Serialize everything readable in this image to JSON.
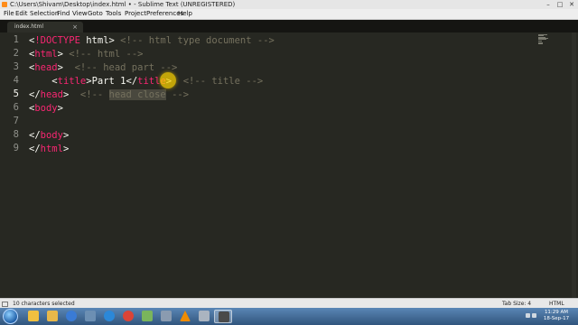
{
  "window": {
    "title": "C:\\Users\\Shivam\\Desktop\\index.html • - Sublime Text (UNREGISTERED)"
  },
  "menu": {
    "items": [
      "File",
      "Edit",
      "Selection",
      "Find",
      "View",
      "Goto",
      "Tools",
      "Project",
      "Preferences",
      "Help"
    ]
  },
  "tab": {
    "label": "index.html",
    "close_glyph": "×"
  },
  "editor": {
    "active_line": 5,
    "line_numbers": [
      "1",
      "2",
      "3",
      "4",
      "5",
      "6",
      "7",
      "8",
      "9"
    ],
    "lines": [
      {
        "indent": "",
        "tokens": [
          [
            "<",
            "punct"
          ],
          [
            "!DOCTYPE",
            "doctype"
          ],
          [
            " html",
            "text"
          ],
          [
            "> ",
            "punct"
          ],
          [
            "<!-- html type document -->",
            "comment"
          ]
        ]
      },
      {
        "indent": "",
        "tokens": [
          [
            "<",
            "punct"
          ],
          [
            "html",
            "tag"
          ],
          [
            "> ",
            "punct"
          ],
          [
            "<!-- html -->",
            "comment"
          ]
        ]
      },
      {
        "indent": "",
        "tokens": [
          [
            "<",
            "punct"
          ],
          [
            "head",
            "tag"
          ],
          [
            ">  ",
            "punct"
          ],
          [
            "<!-- head part -->",
            "comment"
          ]
        ]
      },
      {
        "indent": "    ",
        "tokens": [
          [
            "<",
            "punct"
          ],
          [
            "title",
            "tag"
          ],
          [
            ">",
            "punct"
          ],
          [
            "Part 1",
            "text"
          ],
          [
            "</",
            "punct"
          ],
          [
            "title",
            "tag"
          ],
          [
            ">  ",
            "punct"
          ],
          [
            "<!-- title -->",
            "comment"
          ]
        ]
      },
      {
        "indent": "",
        "tokens": [
          [
            "</",
            "punct"
          ],
          [
            "head",
            "tag"
          ],
          [
            ">  ",
            "punct"
          ],
          [
            "<!-- ",
            "comment"
          ],
          [
            "head close",
            "comment-sel"
          ],
          [
            " -->",
            "comment"
          ]
        ]
      },
      {
        "indent": "",
        "tokens": [
          [
            "<",
            "punct"
          ],
          [
            "body",
            "tag"
          ],
          [
            ">",
            "punct"
          ]
        ]
      },
      {
        "indent": "",
        "tokens": []
      },
      {
        "indent": "",
        "tokens": [
          [
            "</",
            "punct"
          ],
          [
            "body",
            "tag"
          ],
          [
            ">",
            "punct"
          ]
        ]
      },
      {
        "indent": "",
        "tokens": [
          [
            "</",
            "punct"
          ],
          [
            "html",
            "tag"
          ],
          [
            ">",
            "punct"
          ]
        ]
      }
    ]
  },
  "statusbar": {
    "selection": "10 characters selected",
    "tab_size": "Tab Size: 4",
    "syntax": "HTML"
  },
  "taskbar": {
    "apps": [
      "explorer-icon",
      "folder-icon",
      "media-player-icon",
      "app-icon",
      "ie-icon",
      "chrome-icon",
      "documents-icon",
      "app-icon",
      "vlc-icon",
      "app-icon",
      "sublime-text-icon"
    ],
    "clock_time": "11:29 AM",
    "clock_date": "18-Sep-17"
  },
  "colors": {
    "editor_bg": "#272822",
    "tag": "#f92672",
    "comment": "#75715e",
    "text": "#f8f8f2",
    "line_number": "#8f908a"
  }
}
